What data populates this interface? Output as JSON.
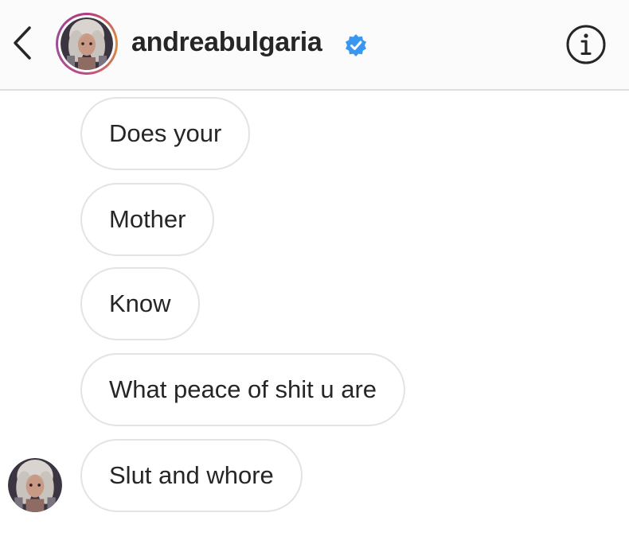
{
  "header": {
    "back_icon": "chevron-left-icon",
    "username": "andreabulgaria",
    "verified_icon": "verified-badge-icon",
    "info_icon": "info-icon",
    "verified_color": "#3897f0"
  },
  "messages": [
    {
      "text": "Does your"
    },
    {
      "text": "Mother"
    },
    {
      "text": "Know"
    },
    {
      "text": "What peace of shit u are"
    },
    {
      "text": "Slut and whore"
    }
  ],
  "colors": {
    "header_bg": "#fbfbfb",
    "bubble_border": "#e3e3e3",
    "text": "#262626"
  }
}
